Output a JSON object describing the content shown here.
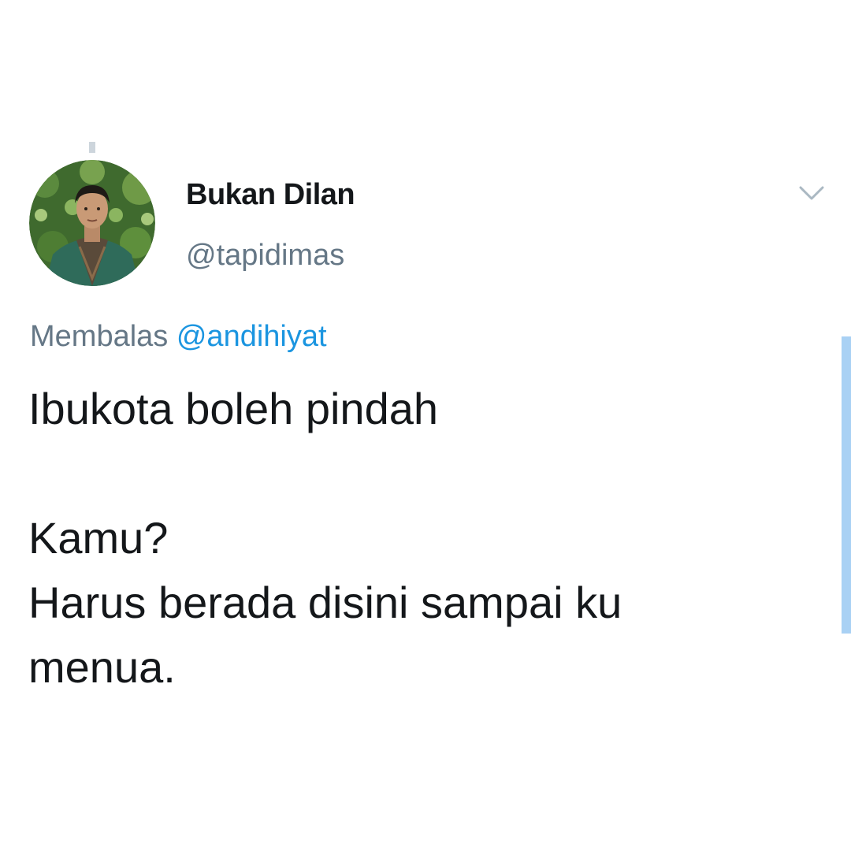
{
  "tweet": {
    "display_name": "Bukan Dilan",
    "handle": "@tapidimas",
    "reply_prefix": "Membalas",
    "reply_to": "@andihiyat",
    "lines": [
      "Ibukota boleh pindah",
      "Kamu?",
      "Harus berada disini sampai ku",
      "menua."
    ]
  },
  "icons": {
    "menu": "chevron-down-icon",
    "avatar": "avatar"
  },
  "colors": {
    "name": "#14171a",
    "secondary": "#657786",
    "link": "#1b95e0",
    "scrollbar": "#a9d1f4"
  }
}
